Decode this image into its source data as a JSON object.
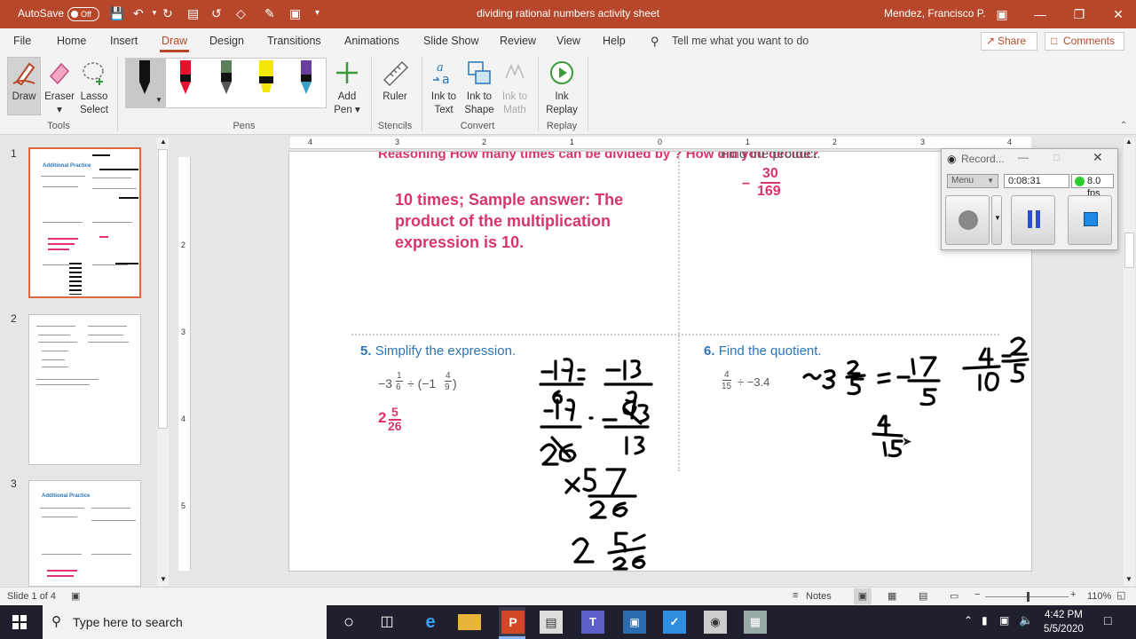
{
  "titlebar": {
    "autosave_label": "AutoSave",
    "autosave_state": "Off",
    "document_title": "dividing rational numbers activity sheet",
    "user_name": "Mendez, Francisco P."
  },
  "menu": {
    "tabs": [
      "File",
      "Home",
      "Insert",
      "Draw",
      "Design",
      "Transitions",
      "Animations",
      "Slide Show",
      "Review",
      "View",
      "Help"
    ],
    "active_tab": "Draw",
    "tell_me": "Tell me what you want to do",
    "share": "Share",
    "comments": "Comments"
  },
  "ribbon": {
    "tools": {
      "draw": "Draw",
      "eraser": "Eraser",
      "lasso_1": "Lasso",
      "lasso_2": "Select",
      "group": "Tools"
    },
    "pens": {
      "group": "Pens",
      "add_pen_1": "Add",
      "add_pen_2": "Pen",
      "pen_colors": [
        "#111111",
        "#e8112d",
        "#5a7f5a",
        "#f5e60a",
        "#3aa0c8"
      ]
    },
    "stencils": {
      "ruler": "Ruler",
      "group": "Stencils"
    },
    "convert": {
      "ink_to_text_1": "Ink to",
      "ink_to_text_2": "Text",
      "ink_to_shape_1": "Ink to",
      "ink_to_shape_2": "Shape",
      "ink_to_math_1": "Ink to",
      "ink_to_math_2": "Math",
      "group": "Convert"
    },
    "replay": {
      "ink_replay_1": "Ink",
      "ink_replay_2": "Replay",
      "group": "Replay"
    }
  },
  "thumbnails": {
    "numbers": [
      "1",
      "2",
      "3"
    ],
    "slide1_title": "Additional Practice",
    "slide3_title": "Additional Practice"
  },
  "slide": {
    "top_left": {
      "cut_text": "Reasoning How many times can be divided by ? How did you decide?",
      "answer_line1": "10 times; Sample answer: The",
      "answer_line2": "product of the multiplication",
      "answer_line3": "expression is 10."
    },
    "top_right": {
      "cut_text": "Find the product.",
      "answer_sign": "−",
      "answer_num": "30",
      "answer_den": "169"
    },
    "q5": {
      "number": "5.",
      "prompt": "Simplify the expression.",
      "expression_part1": "−3",
      "frac1_num": "1",
      "frac1_den": "6",
      "expression_part2": "÷ (−1",
      "frac2_num": "4",
      "frac2_den": "9",
      "expression_part3": ")",
      "answer_whole": "2",
      "answer_num": "5",
      "answer_den": "26"
    },
    "q6": {
      "number": "6.",
      "prompt": "Find the quotient.",
      "frac_num": "4",
      "frac_den": "15",
      "expression_rest": "÷ −3.4"
    }
  },
  "recorder": {
    "title": "Record...",
    "menu_label": "Menu",
    "elapsed": "0:08:31",
    "fps": "8.0 fps"
  },
  "statusbar": {
    "slide_info": "Slide 1 of 4",
    "notes": "Notes",
    "zoom": "110%"
  },
  "taskbar": {
    "search_placeholder": "Type here to search",
    "time": "4:42 PM",
    "date": "5/5/2020"
  },
  "colors": {
    "accent": "#b7472a",
    "answer_pink": "#d9346b",
    "question_blue": "#2b75b7",
    "selection_orange": "#e1673f"
  }
}
